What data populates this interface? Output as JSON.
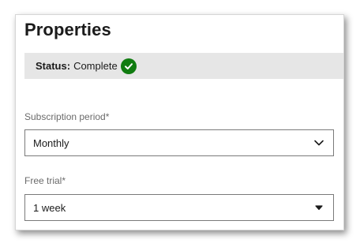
{
  "panel": {
    "title": "Properties",
    "status_label": "Status:",
    "status_value": "Complete",
    "status_icon": "check-circle-icon",
    "status_color": "#107c10"
  },
  "fields": {
    "subscription_period": {
      "label": "Subscription period*",
      "value": "Monthly"
    },
    "free_trial": {
      "label": "Free trial*",
      "value": "1 week"
    }
  }
}
